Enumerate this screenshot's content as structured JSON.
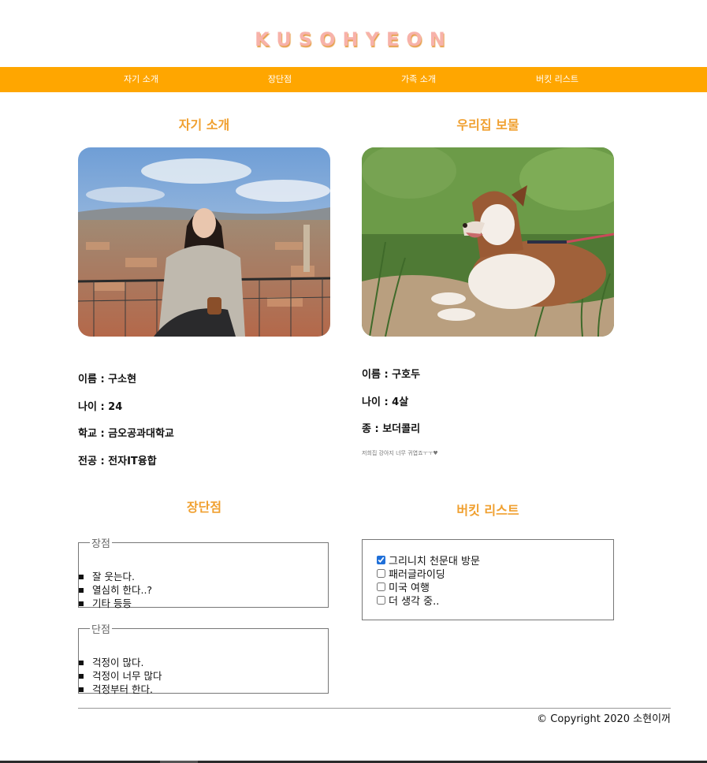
{
  "site": {
    "title": "KUSOHYEON"
  },
  "nav": {
    "items": [
      "자기 소개",
      "장단점",
      "가족 소개",
      "버킷 리스트"
    ]
  },
  "intro": {
    "heading": "자기 소개",
    "photo_description": "woman seated on railing above Florence rooftops",
    "info": [
      "이름 : 구소현",
      "나이 : 24",
      "학교 : 금오공과대학교",
      "전공 : 전자IT융합"
    ]
  },
  "treasure": {
    "heading": "우리집 보물",
    "photo_description": "border collie lying in grass",
    "info": [
      "이름 : 구호두",
      "나이 : 4살",
      "종 : 보더콜리"
    ],
    "note": "저희집 강아지 너무 귀엽죠ㅜㅜ♥"
  },
  "pros_cons": {
    "heading": "장단점",
    "pros": {
      "legend": "장점",
      "items": [
        "잘 웃는다.",
        "열심히 한다..?",
        "기타 등등"
      ]
    },
    "cons": {
      "legend": "단점",
      "items": [
        "걱정이 많다.",
        "걱정이 너무 많다",
        "걱정부터 한다."
      ]
    }
  },
  "bucket": {
    "heading": "버킷 리스트",
    "items": [
      {
        "label": "그리니치 천문대 방문",
        "checked": true
      },
      {
        "label": "패러글라이딩",
        "checked": false
      },
      {
        "label": "미국 여행",
        "checked": false
      },
      {
        "label": "더 생각 중..",
        "checked": false
      }
    ]
  },
  "footer": {
    "copyright": "© Copyright 2020 소현이꺼"
  },
  "colors": {
    "accent": "#ffa600",
    "heading": "#f0a030",
    "title": "#f7b2aa"
  }
}
